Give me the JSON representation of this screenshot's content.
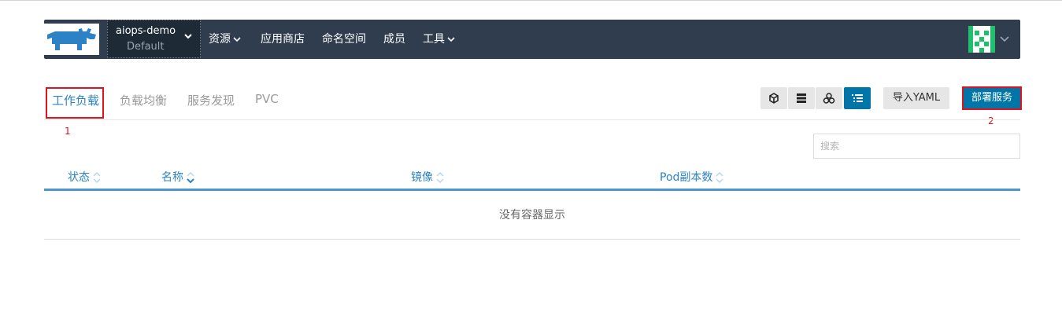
{
  "header": {
    "project": "aiops-demo",
    "environment": "Default",
    "nav": [
      "资源",
      "应用商店",
      "命名空间",
      "成员",
      "工具"
    ]
  },
  "tabs": [
    {
      "label": "工作负载",
      "active": true
    },
    {
      "label": "负载均衡",
      "active": false
    },
    {
      "label": "服务发现",
      "active": false
    },
    {
      "label": "PVC",
      "active": false
    }
  ],
  "annotations": {
    "first": "1",
    "second": "2"
  },
  "toolbar": {
    "view_icons": [
      "cube-icon",
      "server-icon",
      "cluster-icon",
      "list-icon"
    ],
    "import_label": "导入YAML",
    "deploy_label": "部署服务"
  },
  "search": {
    "placeholder": "搜索"
  },
  "table": {
    "columns": [
      "状态",
      "名称",
      "镜像",
      "Pod副本数"
    ],
    "empty_text": "没有容器显示"
  },
  "colors": {
    "navbar": "#2f3d4f",
    "accent": "#2b83c5",
    "primary_button": "#0075a8",
    "highlight_box": "#e3111b"
  }
}
